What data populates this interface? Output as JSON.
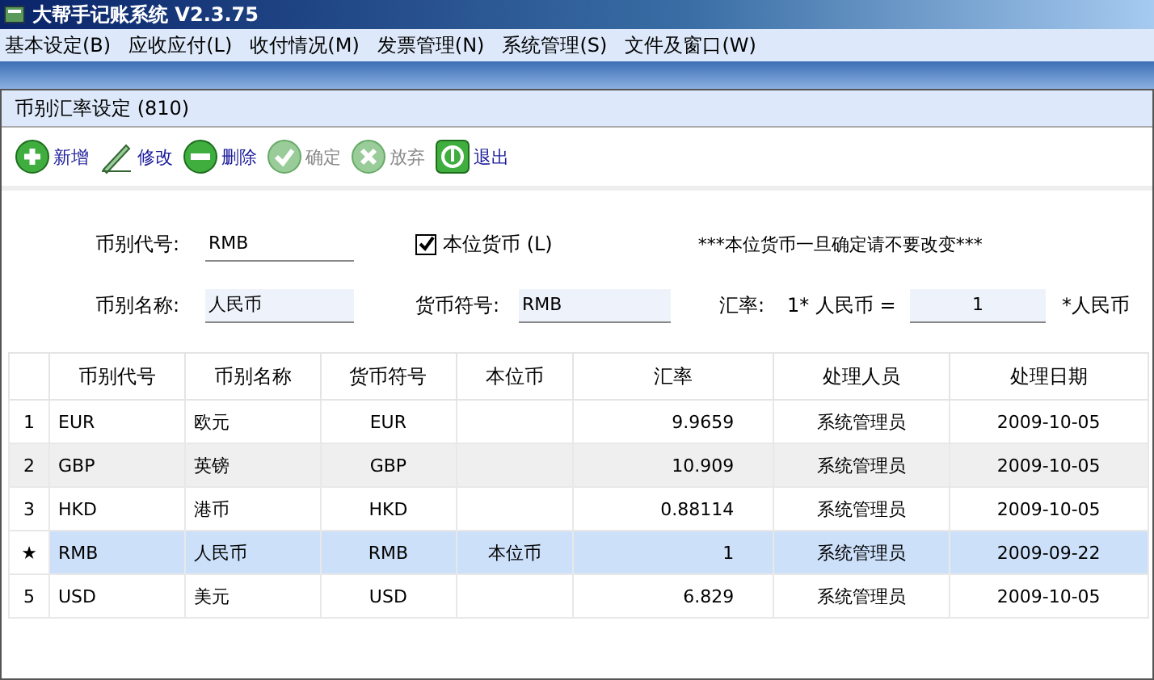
{
  "window": {
    "title": "大帮手记账系统 V2.3.75"
  },
  "menu": [
    "基本设定(B)",
    "应收应付(L)",
    "收付情况(M)",
    "发票管理(N)",
    "系统管理(S)",
    "文件及窗口(W)"
  ],
  "dialog": {
    "title": "币别汇率设定 (810)"
  },
  "toolbar": [
    {
      "kind": "add",
      "label": "新增",
      "disabled": false
    },
    {
      "kind": "edit",
      "label": "修改",
      "disabled": false
    },
    {
      "kind": "delete",
      "label": "删除",
      "disabled": false
    },
    {
      "kind": "confirm",
      "label": "确定",
      "disabled": true
    },
    {
      "kind": "cancel",
      "label": "放弃",
      "disabled": true
    },
    {
      "kind": "exit",
      "label": "退出",
      "disabled": false
    }
  ],
  "form": {
    "code_label": "币别代号:",
    "code_value": "RMB",
    "base_checkbox": {
      "label": "本位货币 (L)",
      "checked": true
    },
    "warning": "***本位货币一旦确定请不要改变***",
    "name_label": "币别名称:",
    "name_value": "人民币",
    "symbol_label": "货币符号:",
    "symbol_value": "RMB",
    "rate_label": "汇率:",
    "rate_prefix": "1* 人民币 =",
    "rate_value": "1",
    "rate_suffix": "*人民币"
  },
  "table": {
    "columns": [
      "币别代号",
      "币别名称",
      "货币符号",
      "本位币",
      "汇率",
      "处理人员",
      "处理日期"
    ],
    "rows": [
      {
        "marker": "1",
        "selected": false,
        "cells": [
          "EUR",
          "欧元",
          "EUR",
          "",
          "9.9659",
          "系统管理员",
          "2009-10-05"
        ]
      },
      {
        "marker": "2",
        "selected": false,
        "cells": [
          "GBP",
          "英镑",
          "GBP",
          "",
          "10.909",
          "系统管理员",
          "2009-10-05"
        ]
      },
      {
        "marker": "3",
        "selected": false,
        "cells": [
          "HKD",
          "港币",
          "HKD",
          "",
          "0.88114",
          "系统管理员",
          "2009-10-05"
        ]
      },
      {
        "marker": "★",
        "selected": true,
        "cells": [
          "RMB",
          "人民币",
          "RMB",
          "本位币",
          "1",
          "系统管理员",
          "2009-09-22"
        ]
      },
      {
        "marker": "5",
        "selected": false,
        "cells": [
          "USD",
          "美元",
          "USD",
          "",
          "6.829",
          "系统管理员",
          "2009-10-05"
        ]
      }
    ]
  }
}
